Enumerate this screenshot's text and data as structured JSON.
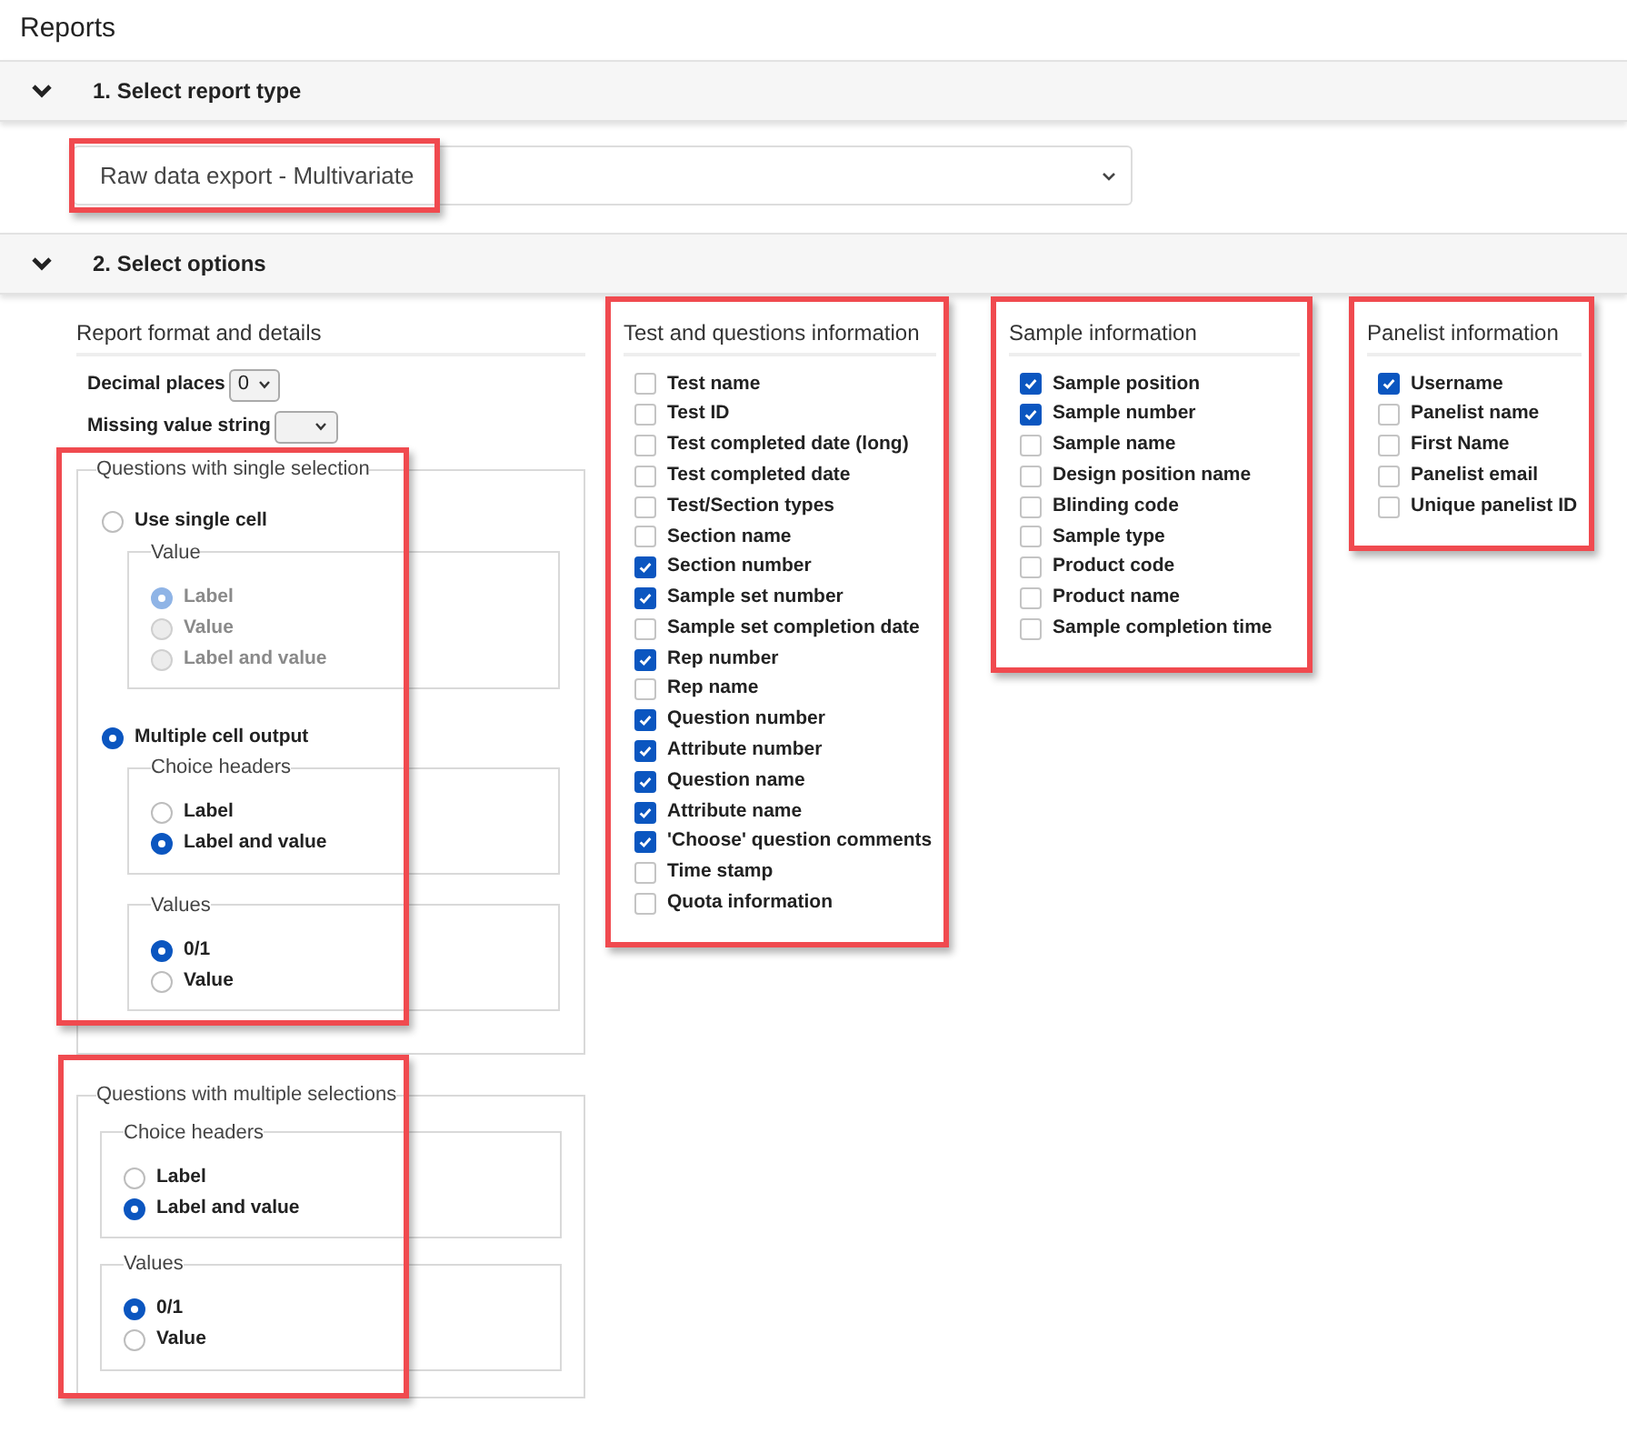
{
  "page_title": "Reports",
  "sections": [
    {
      "title": "1. Select report type",
      "expanded": true
    },
    {
      "title": "2. Select options",
      "expanded": true
    }
  ],
  "report_type": {
    "value": "Raw data export - Multivariate"
  },
  "format": {
    "heading": "Report format and details",
    "decimal_places": {
      "label": "Decimal places",
      "value": "0"
    },
    "missing_value": {
      "label": "Missing value string"
    }
  },
  "single_selection": {
    "legend": "Questions with single selection",
    "options": [
      {
        "label": "Use single cell",
        "selected": false,
        "groups": [
          {
            "legend": "Value",
            "disabled": true,
            "options": [
              {
                "label": "Label",
                "selected": true
              },
              {
                "label": "Value",
                "selected": false
              },
              {
                "label": "Label and value",
                "selected": false
              }
            ]
          }
        ]
      },
      {
        "label": "Multiple cell output",
        "selected": true,
        "groups": [
          {
            "legend": "Choice headers",
            "disabled": false,
            "options": [
              {
                "label": "Label",
                "selected": false
              },
              {
                "label": "Label and value",
                "selected": true
              }
            ]
          },
          {
            "legend": "Values",
            "disabled": false,
            "options": [
              {
                "label": "0/1",
                "selected": true
              },
              {
                "label": "Value",
                "selected": false
              }
            ]
          }
        ]
      }
    ]
  },
  "multiple_selection": {
    "legend": "Questions with multiple selections",
    "groups": [
      {
        "legend": "Choice headers",
        "disabled": false,
        "options": [
          {
            "label": "Label",
            "selected": false
          },
          {
            "label": "Label and value",
            "selected": true
          }
        ]
      },
      {
        "legend": "Values",
        "disabled": false,
        "options": [
          {
            "label": "0/1",
            "selected": true
          },
          {
            "label": "Value",
            "selected": false
          }
        ]
      }
    ]
  },
  "columns": [
    {
      "title": "Test and questions information",
      "items": [
        {
          "label": "Test name",
          "checked": false
        },
        {
          "label": "Test ID",
          "checked": false
        },
        {
          "label": "Test completed date (long)",
          "checked": false
        },
        {
          "label": "Test completed date",
          "checked": false
        },
        {
          "label": "Test/Section types",
          "checked": false
        },
        {
          "label": "Section name",
          "checked": false
        },
        {
          "label": "Section number",
          "checked": true
        },
        {
          "label": "Sample set number",
          "checked": true
        },
        {
          "label": "Sample set completion date",
          "checked": false
        },
        {
          "label": "Rep number",
          "checked": true
        },
        {
          "label": "Rep name",
          "checked": false
        },
        {
          "label": "Question number",
          "checked": true
        },
        {
          "label": "Attribute number",
          "checked": true
        },
        {
          "label": "Question name",
          "checked": true
        },
        {
          "label": "Attribute name",
          "checked": true
        },
        {
          "label": "'Choose' question comments",
          "checked": true
        },
        {
          "label": "Time stamp",
          "checked": false
        },
        {
          "label": "Quota information",
          "checked": false
        }
      ]
    },
    {
      "title": "Sample information",
      "items": [
        {
          "label": "Sample position",
          "checked": true
        },
        {
          "label": "Sample number",
          "checked": true
        },
        {
          "label": "Sample name",
          "checked": false
        },
        {
          "label": "Design position name",
          "checked": false
        },
        {
          "label": "Blinding code",
          "checked": false
        },
        {
          "label": "Sample type",
          "checked": false
        },
        {
          "label": "Product code",
          "checked": false
        },
        {
          "label": "Product name",
          "checked": false
        },
        {
          "label": "Sample completion time",
          "checked": false
        }
      ]
    },
    {
      "title": "Panelist information",
      "items": [
        {
          "label": "Username",
          "checked": true
        },
        {
          "label": "Panelist name",
          "checked": false
        },
        {
          "label": "First Name",
          "checked": false
        },
        {
          "label": "Panelist email",
          "checked": false
        },
        {
          "label": "Unique panelist ID",
          "checked": false
        }
      ]
    }
  ]
}
